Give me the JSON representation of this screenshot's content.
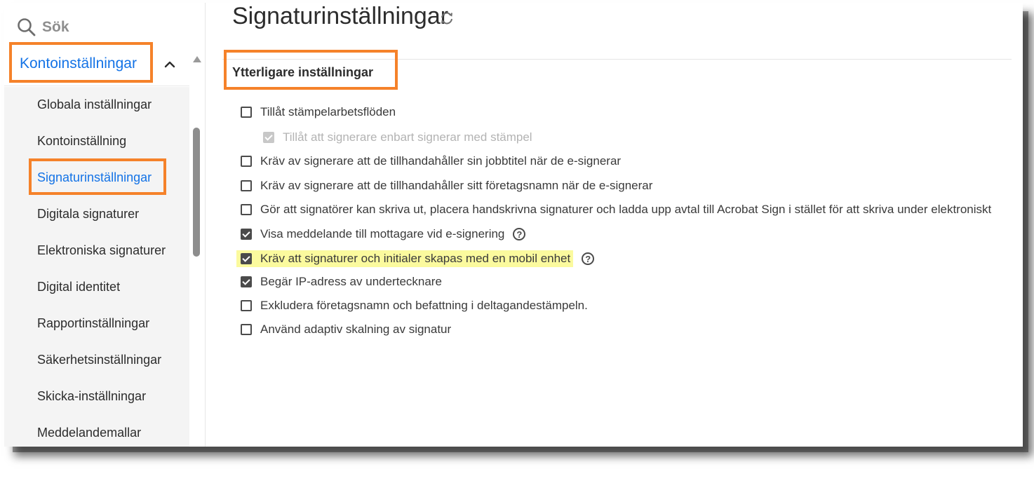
{
  "search": {
    "placeholder": "Sök",
    "icon": "search-icon"
  },
  "sidebar": {
    "section_label": "Kontoinställningar",
    "items": [
      {
        "label": "Globala inställningar",
        "active": false
      },
      {
        "label": "Kontoinställning",
        "active": false
      },
      {
        "label": "Signaturinställningar",
        "active": true
      },
      {
        "label": "Digitala signaturer",
        "active": false
      },
      {
        "label": "Elektroniska signaturer",
        "active": false
      },
      {
        "label": "Digital identitet",
        "active": false
      },
      {
        "label": "Rapportinställningar",
        "active": false
      },
      {
        "label": "Säkerhetsinställningar",
        "active": false
      },
      {
        "label": "Skicka-inställningar",
        "active": false
      },
      {
        "label": "Meddelandemallar",
        "active": false
      }
    ]
  },
  "main": {
    "title": "Signaturinställningar",
    "group_title": "Ytterligare inställningar",
    "options": [
      {
        "label": "Tillåt stämpelarbetsflöden",
        "checked": false
      },
      {
        "label": "Tillåt att signerare enbart signerar med stämpel",
        "checked": true,
        "disabled": true
      },
      {
        "label": "Kräv av signerare att de tillhandahåller sin jobbtitel när de e-signerar",
        "checked": false
      },
      {
        "label": "Kräv av signerare att de tillhandahåller sitt företagsnamn när de e-signerar",
        "checked": false
      },
      {
        "label": "Gör att signatörer kan skriva ut, placera handskrivna signaturer och ladda upp avtal till Acrobat Sign i stället för att skriva under elektroniskt",
        "checked": false
      },
      {
        "label": "Visa meddelande till mottagare vid e-signering",
        "checked": true,
        "help": "?"
      },
      {
        "label": "Kräv att signaturer och initialer skapas med en mobil enhet",
        "checked": true,
        "help": "?",
        "highlighted": true
      },
      {
        "label": "Begär IP-adress av undertecknare",
        "checked": true
      },
      {
        "label": "Exkludera företagsnamn och befattning i deltagandestämpeln.",
        "checked": false
      },
      {
        "label": "Använd adaptiv skalning av signatur",
        "checked": false
      }
    ]
  },
  "colors": {
    "accent": "#1473e6",
    "callout": "#f5822a",
    "highlight": "#fbfa9e"
  }
}
